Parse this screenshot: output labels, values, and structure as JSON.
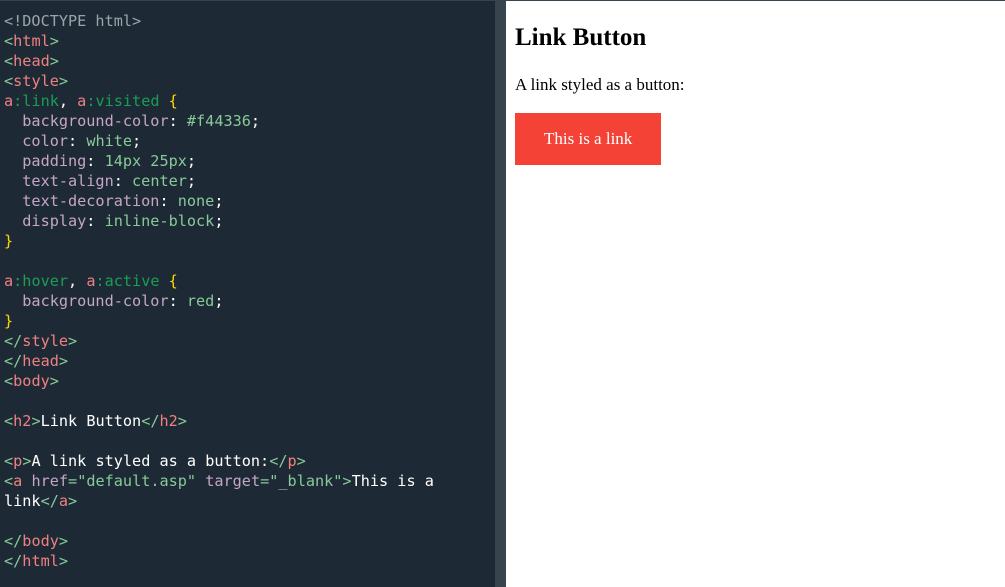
{
  "editor": {
    "lines": {
      "l1": "<!DOCTYPE html>",
      "l2_tag": "html",
      "l3_tag": "head",
      "l4_tag": "style",
      "l5": {
        "sel1": "a",
        "pseudo1": ":link",
        "comma": ", ",
        "sel2": "a",
        "pseudo2": ":visited",
        "brace": " {"
      },
      "l6": {
        "prop": "  background-color",
        "colon": ": ",
        "val": "#f44336",
        "semi": ";"
      },
      "l7": {
        "prop": "  color",
        "colon": ": ",
        "val": "white",
        "semi": ";"
      },
      "l8": {
        "prop": "  padding",
        "colon": ": ",
        "val": "14px 25px",
        "semi": ";"
      },
      "l9": {
        "prop": "  text-align",
        "colon": ": ",
        "val": "center",
        "semi": ";"
      },
      "l10": {
        "prop": "  text-decoration",
        "colon": ": ",
        "val": "none",
        "semi": ";"
      },
      "l11": {
        "prop": "  display",
        "colon": ": ",
        "val": "inline-block",
        "semi": ";"
      },
      "l12": "}",
      "l14": {
        "sel1": "a",
        "pseudo1": ":hover",
        "comma": ", ",
        "sel2": "a",
        "pseudo2": ":active",
        "brace": " {"
      },
      "l15": {
        "prop": "  background-color",
        "colon": ": ",
        "val": "red",
        "semi": ";"
      },
      "l16": "}",
      "l17_tag": "style",
      "l18_tag": "head",
      "l19_tag": "body",
      "l21": {
        "tag": "h2",
        "text": "Link Button"
      },
      "l23": {
        "tag": "p",
        "text": "A link styled as a button:"
      },
      "l24": {
        "tag": "a",
        "attr1": "href",
        "val1": "\"default.asp\"",
        "attr2": "target",
        "val2": "\"_blank\"",
        "text": "This is a"
      },
      "l25": {
        "text": "link",
        "tag": "a"
      },
      "l27_tag": "body",
      "l28_tag": "html"
    }
  },
  "preview": {
    "heading": "Link Button",
    "paragraph": "A link styled as a button:",
    "link_button": "This is a link",
    "button_color": "#f44336"
  },
  "theme": {
    "editor_bg": "#1d2a35",
    "divider": "#38444d"
  }
}
